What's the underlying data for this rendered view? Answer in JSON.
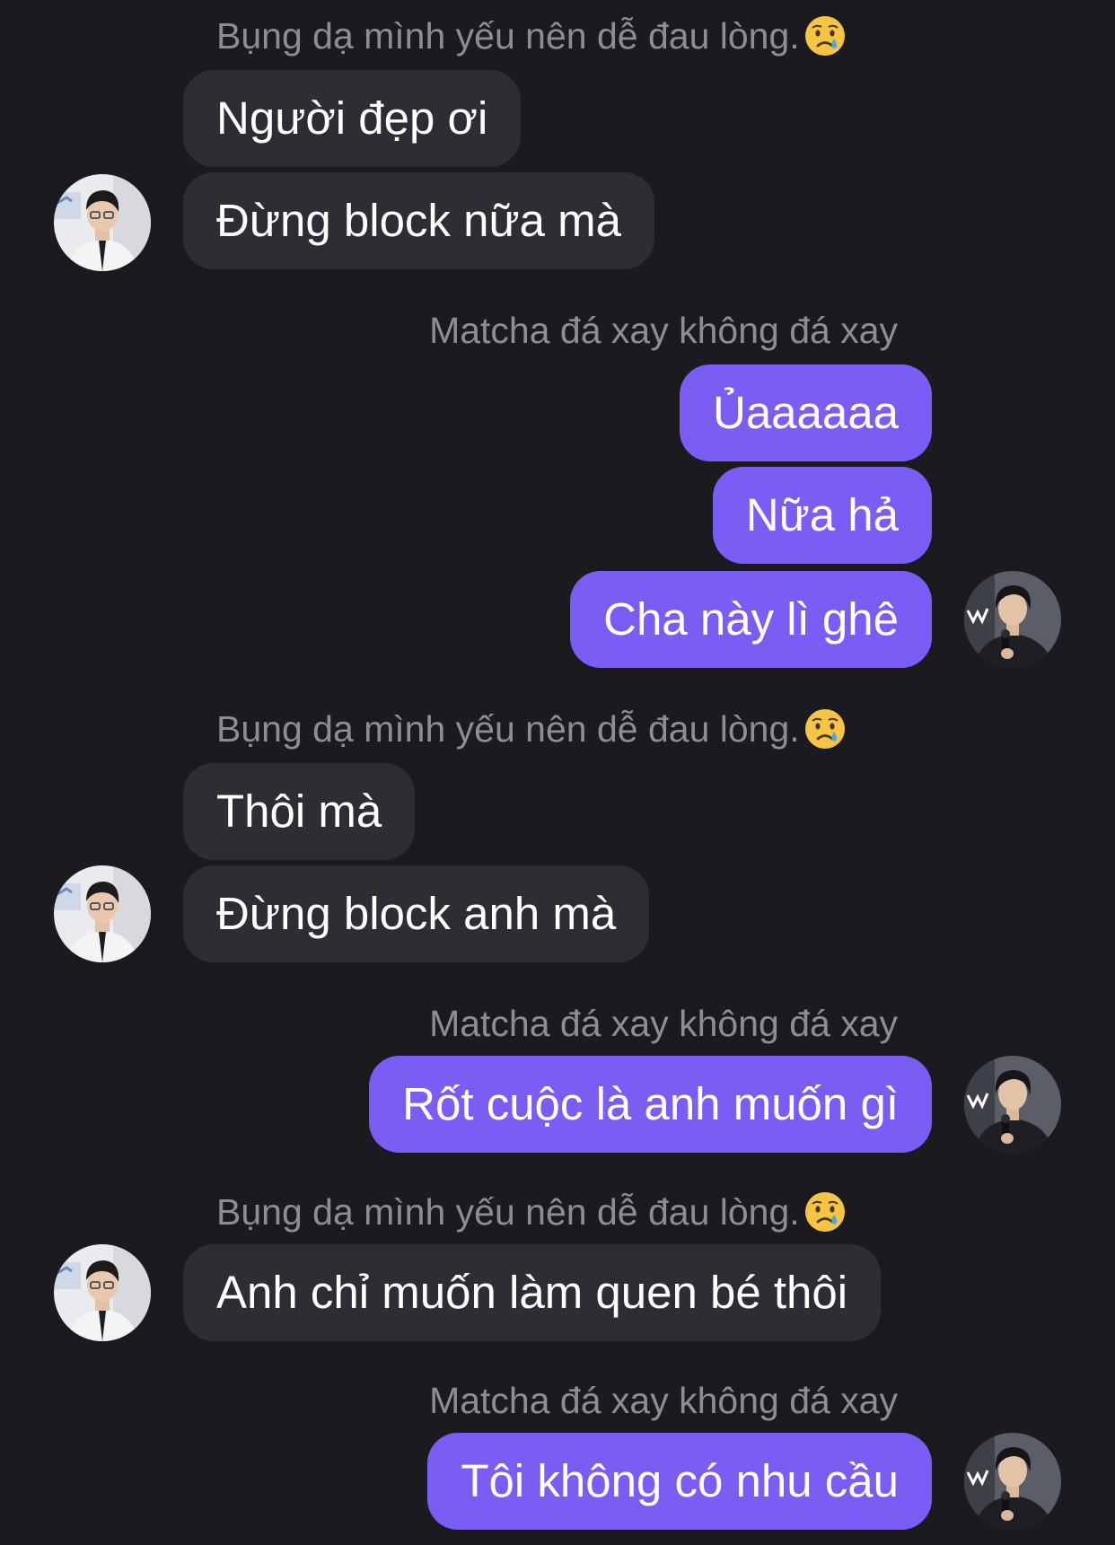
{
  "colors": {
    "background": "#1b1a1f",
    "incoming_bubble": "#2e2d33",
    "outgoing_bubble": "#7b5cf5",
    "sender_name": "#8e8d93"
  },
  "contacts": {
    "other": "Bụng dạ mình yếu nên dễ đau lòng.",
    "self": "Matcha đá xay không đá xay"
  },
  "messages": [
    {
      "sender": "other",
      "text": "Người đẹp ơi"
    },
    {
      "sender": "other",
      "text": "Đừng block nữa mà"
    },
    {
      "sender": "self",
      "text": "Ủaaaaaa"
    },
    {
      "sender": "self",
      "text": "Nữa hả"
    },
    {
      "sender": "self",
      "text": "Cha này lì ghê"
    },
    {
      "sender": "other",
      "text": "Thôi mà"
    },
    {
      "sender": "other",
      "text": "Đừng block anh mà"
    },
    {
      "sender": "self",
      "text": "Rốt cuộc là anh muốn gì"
    },
    {
      "sender": "other",
      "text": "Anh chỉ muốn làm quen bé thôi"
    },
    {
      "sender": "self",
      "text": "Tôi không có nhu cầu"
    }
  ],
  "icons": {
    "sender_emoji": "crying-face-icon",
    "other_avatar": "man-in-suit-avatar",
    "self_avatar": "man-with-microphone-avatar"
  }
}
